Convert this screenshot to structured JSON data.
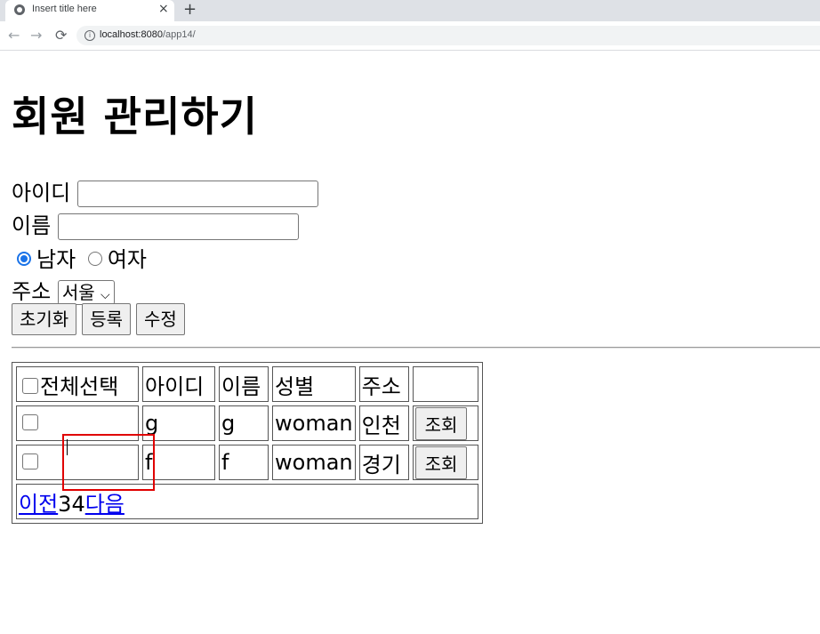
{
  "browser": {
    "tab_title": "Insert title here",
    "tab_close": "×",
    "new_tab": "+",
    "url_host": "localhost:8080",
    "url_path": "/app14/",
    "back": "←",
    "forward": "→",
    "reload": "⟳",
    "info": "i"
  },
  "page": {
    "heading": "회원 관리하기",
    "form": {
      "id_label": "아이디",
      "id_value": "",
      "name_label": "이름",
      "name_value": "",
      "gender_male": "남자",
      "gender_female": "여자",
      "gender_selected": "남자",
      "address_label": "주소",
      "address_selected": "서울",
      "buttons": {
        "reset": "초기화",
        "register": "등록",
        "modify": "수정"
      }
    },
    "table": {
      "headers": {
        "select_all": "전체선택",
        "id": "아이디",
        "name": "이름",
        "gender": "성별",
        "address": "주소"
      },
      "rows": [
        {
          "id": "g",
          "name": "g",
          "gender": "woman",
          "address": "인천",
          "action": "조회"
        },
        {
          "id": "f",
          "name": "f",
          "gender": "woman",
          "address": "경기",
          "action": "조회"
        }
      ],
      "pagination": {
        "prev": "이전",
        "pages": "34",
        "next": "다음"
      }
    }
  }
}
